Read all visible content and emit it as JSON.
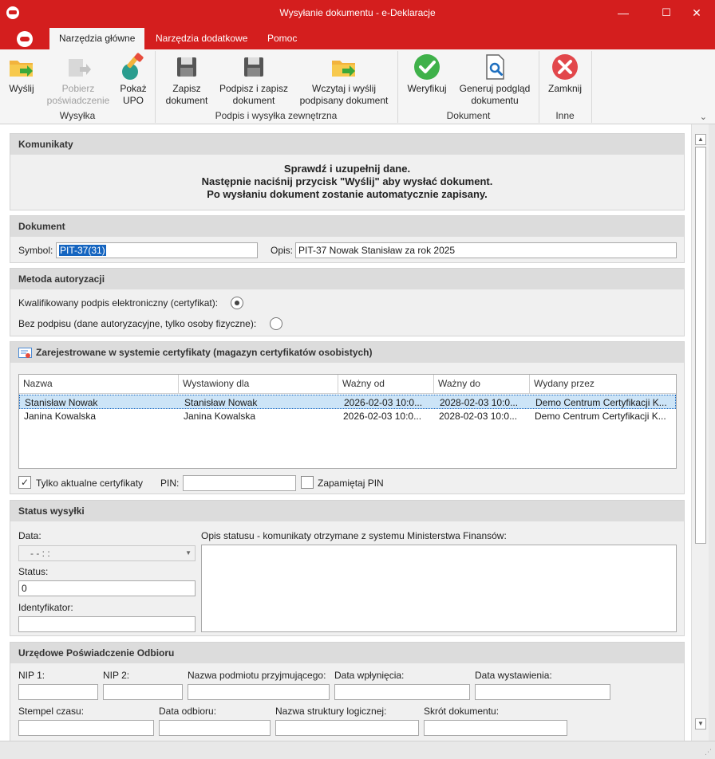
{
  "window": {
    "title": "Wysyłanie dokumentu - e-Deklaracje",
    "minimize": "—",
    "maximize": "☐",
    "close": "✕"
  },
  "tabs": [
    "Narzędzia główne",
    "Narzędzia dodatkowe",
    "Pomoc"
  ],
  "ribbon": {
    "buttons": {
      "wyslij": "Wyślij",
      "pobierz_1": "Pobierz",
      "pobierz_2": "poświadczenie",
      "pokaz_1": "Pokaż",
      "pokaz_2": "UPO",
      "zapisz_1": "Zapisz",
      "zapisz_2": "dokument",
      "podpisz_1": "Podpisz i zapisz",
      "podpisz_2": "dokument",
      "wczytaj_1": "Wczytaj i wyślij",
      "wczytaj_2": "podpisany dokument",
      "weryfikuj": "Weryfikuj",
      "generuj_1": "Generuj podgląd",
      "generuj_2": "dokumentu",
      "zamknij": "Zamknij"
    },
    "groups": {
      "wysylka": "Wysyłka",
      "podpis": "Podpis i wysyłka zewnętrzna",
      "dokument": "Dokument",
      "inne": "Inne"
    },
    "collapse_icon": "chevron-down-icon"
  },
  "komunikaty": {
    "header": "Komunikaty",
    "line1": "Sprawdź i uzupełnij dane.",
    "line2": "Następnie naciśnij przycisk \"Wyślij\" aby wysłać dokument.",
    "line3": "Po wysłaniu dokument zostanie automatycznie zapisany."
  },
  "dokument": {
    "header": "Dokument",
    "symbol_label": "Symbol:",
    "symbol_value": "PIT-37(31)",
    "opis_label": "Opis:",
    "opis_value": "PIT-37 Nowak Stanisław za rok 2025"
  },
  "metoda": {
    "header": "Metoda autoryzacji",
    "option1": "Kwalifikowany podpis elektroniczny (certyfikat):",
    "option2": "Bez podpisu (dane autoryzacyjne, tylko osoby fizyczne):",
    "selected": 1
  },
  "certyfikaty": {
    "header": "Zarejestrowane w systemie certyfikaty (magazyn certyfikatów osobistych)",
    "columns": [
      "Nazwa",
      "Wystawiony dla",
      "Ważny od",
      "Ważny do",
      "Wydany przez"
    ],
    "rows": [
      [
        "Stanisław Nowak",
        "Stanisław Nowak",
        "2026-02-03 10:0...",
        "2028-02-03 10:0...",
        "Demo Centrum Certyfikacji K..."
      ],
      [
        "Janina Kowalska",
        "Janina Kowalska",
        "2026-02-03 10:0...",
        "2028-02-03 10:0...",
        "Demo Centrum Certyfikacji K..."
      ]
    ],
    "tylko_aktualne": "Tylko aktualne certyfikaty",
    "tylko_aktualne_checked": true,
    "pin_label": "PIN:",
    "pin_value": "",
    "zapamietaj": "Zapamiętaj PIN",
    "zapamietaj_checked": false
  },
  "status": {
    "header": "Status wysyłki",
    "data_label": "Data:",
    "data_value": "- -     : :",
    "status_label": "Status:",
    "status_value": "0",
    "id_label": "Identyfikator:",
    "id_value": "",
    "opis_label": "Opis statusu - komunikaty otrzymane z systemu Ministerstwa Finansów:"
  },
  "upo": {
    "header": "Urzędowe Poświadczenie Odbioru",
    "nip1": "NIP 1:",
    "nip2": "NIP 2:",
    "nazwa_podmiotu": "Nazwa podmiotu przyjmującego:",
    "data_wplyniecia": "Data wpłynięcia:",
    "data_wystawienia": "Data wystawienia:",
    "stempel": "Stempel czasu:",
    "data_odbioru": "Data odbioru:",
    "nazwa_struktury": "Nazwa struktury logicznej:",
    "skrot": "Skrót dokumentu:"
  },
  "colors": {
    "accent": "#d41e1e",
    "selection": "#1565c0",
    "row_selected": "#cce4f7"
  }
}
